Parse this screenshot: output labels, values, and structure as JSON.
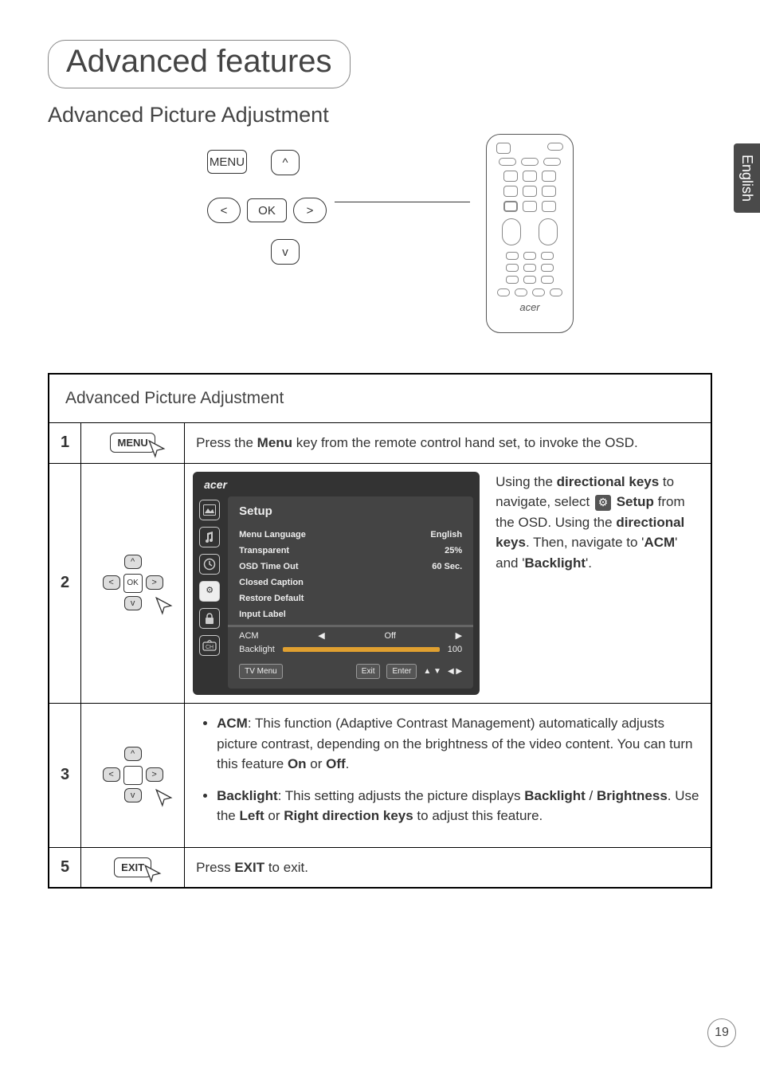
{
  "page": {
    "title": "Advanced features",
    "subtitle": "Advanced Picture Adjustment",
    "language_tab": "English",
    "page_number": "19"
  },
  "dpad": {
    "menu": "MENU",
    "ok": "OK",
    "up": "^",
    "down": "v",
    "left": "<",
    "right": ">"
  },
  "remote_brand": "acer",
  "table": {
    "header": "Advanced Picture Adjustment",
    "rows": {
      "r1": {
        "num": "1",
        "btn": "MENU",
        "text_before": "Press the ",
        "key1": "Menu",
        "text_after": " key from the remote control hand set, to invoke the OSD."
      },
      "r2": {
        "num": "2",
        "ok": "OK",
        "t1": "Using the ",
        "b1": "directional keys",
        "t2": " to navigate, select ",
        "b2": "Setup",
        "t3": " from the OSD. Using the ",
        "b3": "directional keys",
        "t4": ". Then, navigate to '",
        "b4": "ACM",
        "t5": "' and '",
        "b5": "Backlight",
        "t6": "'."
      },
      "r3": {
        "num": "3",
        "acm_b": "ACM",
        "acm_t1": ": This function (Adaptive Contrast Management) automatically adjusts picture contrast, depending on the brightness of the video content. You can turn this feature ",
        "on": "On",
        "or": " or ",
        "off": "Off",
        "dot": ".",
        "bl_b": "Backlight",
        "bl_t1": ": This setting adjusts the picture displays ",
        "bl_b2": "Backlight",
        "slash": " / ",
        "bl_b3": "Brightness",
        "bl_t2": ". Use the ",
        "bl_b4": "Left",
        "bl_t3": " or ",
        "bl_b5": "Right direction keys",
        "bl_t4": " to adjust this feature."
      },
      "r5": {
        "num": "5",
        "btn": "EXIT",
        "t1": "Press ",
        "b1": "EXIT",
        "t2": " to exit."
      }
    }
  },
  "osd": {
    "brand": "acer",
    "title": "Setup",
    "items": {
      "menu_lang_l": "Menu Language",
      "menu_lang_v": "English",
      "transp_l": "Transparent",
      "transp_v": "25%",
      "timeout_l": "OSD Time Out",
      "timeout_v": "60 Sec.",
      "cc_l": "Closed Caption",
      "restore_l": "Restore Default",
      "input_l": "Input Label",
      "acm_l": "ACM",
      "acm_v": "Off",
      "bl_l": "Backlight",
      "bl_v": "100"
    },
    "nav": {
      "tvmenu": "TV Menu",
      "exit": "Exit",
      "enter": "Enter",
      "ud": "▲ ▼",
      "lr": "◀  ▶"
    },
    "tabs_gear": "⚙"
  }
}
